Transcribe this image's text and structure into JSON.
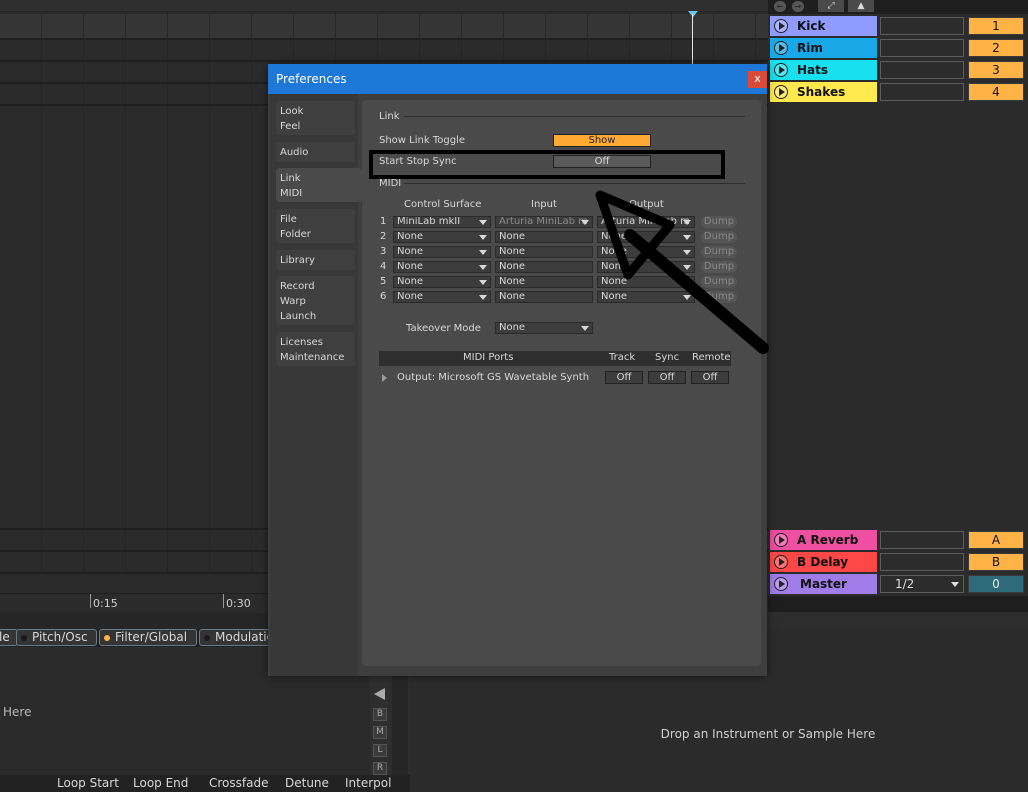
{
  "arrangement": {
    "time_ticks": [
      "0:15",
      "0:30"
    ]
  },
  "device_tabs": [
    {
      "label": "le",
      "dot_color": "#1a1a1a"
    },
    {
      "label": "Pitch/Osc",
      "dot_color": "#1a1a1a"
    },
    {
      "label": "Filter/Global",
      "dot_color": "#ffb347"
    },
    {
      "label": "Modulation",
      "dot_color": "#1a1a1a"
    }
  ],
  "device_area": {
    "drop_hint_partial": "Here",
    "side_buttons": [
      "B",
      "M",
      "L",
      "R"
    ]
  },
  "bottom_labels": [
    "Loop Start",
    "Loop End",
    "Crossfade",
    "Detune",
    "Interpol"
  ],
  "dropzone": {
    "text": "Drop an Instrument or Sample Here"
  },
  "session": {
    "tracks": [
      {
        "name": "Kick",
        "color": "#8f9bff",
        "number": "1"
      },
      {
        "name": "Rim",
        "color": "#18a8e8",
        "number": "2"
      },
      {
        "name": "Hats",
        "color": "#18e0ee",
        "number": "3"
      },
      {
        "name": "Shakes",
        "color": "#ffe94d",
        "number": "4"
      }
    ],
    "returns": [
      {
        "name": "A Reverb",
        "color": "#ee4fa0",
        "number": "A"
      },
      {
        "name": "B Delay",
        "color": "#ff4747",
        "number": "B"
      }
    ],
    "master": {
      "name": "Master",
      "color": "#a07ce8",
      "routing": "1/2",
      "number": "0",
      "number_color": "#2e6b7a"
    }
  },
  "preferences": {
    "title": "Preferences",
    "close_label": "x",
    "sidebar_tabs": [
      {
        "label": "Look\nFeel"
      },
      {
        "label": "Audio"
      },
      {
        "label": "Link\nMIDI"
      },
      {
        "label": "File\nFolder"
      },
      {
        "label": "Library"
      },
      {
        "label": "Record\nWarp\nLaunch"
      },
      {
        "label": "Licenses\nMaintenance"
      }
    ],
    "link_section": {
      "heading": "Link",
      "show_link_toggle_label": "Show Link Toggle",
      "show_link_toggle_value": "Show",
      "start_stop_sync_label": "Start Stop Sync",
      "start_stop_sync_value": "Off"
    },
    "midi_section": {
      "heading": "MIDI",
      "col_control_surface": "Control Surface",
      "col_input": "Input",
      "col_output": "Output",
      "rows": [
        {
          "num": "1",
          "surface": "MiniLab mkII",
          "input": "Arturia MiniLab m",
          "output": "Arturia MiniLab m",
          "dump": "Dump"
        },
        {
          "num": "2",
          "surface": "None",
          "input": "None",
          "output": "None",
          "dump": "Dump"
        },
        {
          "num": "3",
          "surface": "None",
          "input": "None",
          "output": "None",
          "dump": "Dump"
        },
        {
          "num": "4",
          "surface": "None",
          "input": "None",
          "output": "None",
          "dump": "Dump"
        },
        {
          "num": "5",
          "surface": "None",
          "input": "None",
          "output": "None",
          "dump": "Dump"
        },
        {
          "num": "6",
          "surface": "None",
          "input": "None",
          "output": "None",
          "dump": "Dump"
        }
      ],
      "takeover_label": "Takeover Mode",
      "takeover_value": "None",
      "ports_header": "MIDI Ports",
      "ports_track": "Track",
      "ports_sync": "Sync",
      "ports_remote": "Remote",
      "port_row": {
        "label": "Output:  Microsoft GS Wavetable Synth",
        "track": "Off",
        "sync": "Off",
        "remote": "Off"
      }
    }
  }
}
